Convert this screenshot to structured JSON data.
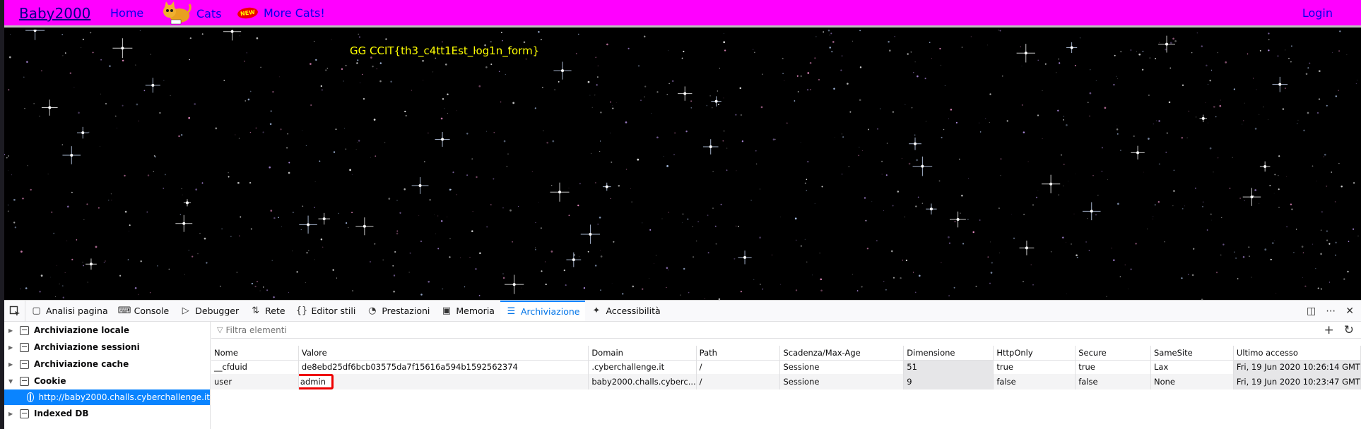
{
  "site": {
    "brand": "Baby2000",
    "nav": {
      "home": "Home",
      "cats": "Cats",
      "new_badge": "NEW",
      "more_cats": "More Cats!",
      "login": "Login"
    },
    "flag_text": "GG CCIT{th3_c4tt1Est_log1n_form}",
    "colors": {
      "nav_bg": "#ff00ff",
      "nav_link": "#0000ee",
      "flag": "#ffff00",
      "background": "#000000"
    }
  },
  "devtools": {
    "tabs": [
      {
        "label": "Analisi pagina",
        "icon": "inspector-icon"
      },
      {
        "label": "Console",
        "icon": "console-icon"
      },
      {
        "label": "Debugger",
        "icon": "debugger-icon"
      },
      {
        "label": "Rete",
        "icon": "network-icon"
      },
      {
        "label": "Editor stili",
        "icon": "style-editor-icon"
      },
      {
        "label": "Prestazioni",
        "icon": "performance-icon"
      },
      {
        "label": "Memoria",
        "icon": "memory-icon"
      },
      {
        "label": "Archiviazione",
        "icon": "storage-icon",
        "active": true
      },
      {
        "label": "Accessibilità",
        "icon": "accessibility-icon"
      }
    ],
    "sidebar": {
      "items": [
        {
          "label": "Archiviazione locale",
          "expanded": false
        },
        {
          "label": "Archiviazione sessioni",
          "expanded": false
        },
        {
          "label": "Archiviazione cache",
          "expanded": false
        },
        {
          "label": "Cookie",
          "expanded": true
        },
        {
          "label": "Indexed DB",
          "expanded": false
        }
      ],
      "cookie_host": "http://baby2000.challs.cyberchallenge.it"
    },
    "filter_placeholder": "Filtra elementi",
    "table": {
      "columns": [
        "Nome",
        "Valore",
        "Domain",
        "Path",
        "Scadenza/Max-Age",
        "Dimensione",
        "HttpOnly",
        "Secure",
        "SameSite",
        "Ultimo accesso"
      ],
      "rows": [
        [
          "__cfduid",
          "de8ebd25df6bcb03575da7f15616a594b1592562374",
          ".cyberchallenge.it",
          "/",
          "Sessione",
          "51",
          "true",
          "true",
          "Lax",
          "Fri, 19 Jun 2020 10:26:14 GMT"
        ],
        [
          "user",
          "admin",
          "baby2000.challs.cyberc...",
          "/",
          "Sessione",
          "9",
          "false",
          "false",
          "None",
          "Fri, 19 Jun 2020 10:23:47 GMT"
        ]
      ]
    },
    "colors": {
      "accent": "#0a84ff",
      "highlight_box": "#ee0000"
    }
  }
}
